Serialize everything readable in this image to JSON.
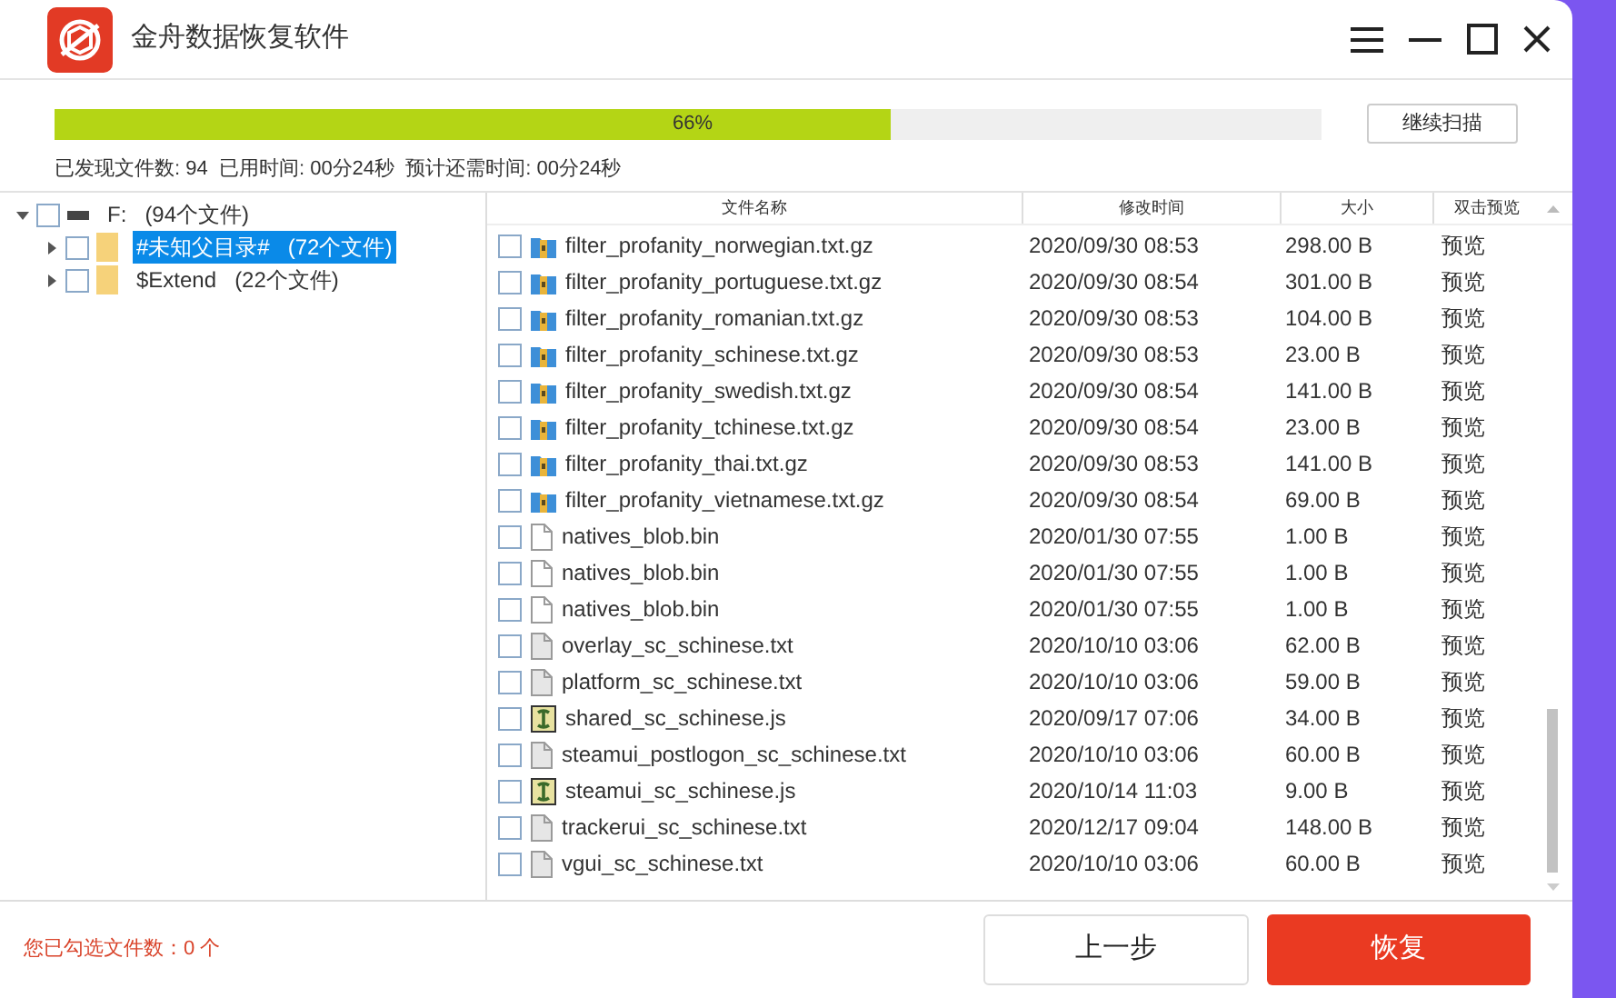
{
  "window": {
    "title": "金舟数据恢复软件"
  },
  "scan": {
    "level": 0.66,
    "percent": "66%",
    "button": "继续扫描",
    "stats": "已发现文件数: 94  已用时间: 00分24秒  预计还需时间: 00分24秒"
  },
  "tree": [
    {
      "label": "F:",
      "count": "(94个文件)",
      "kind": "drive",
      "expanded": true,
      "checked": false,
      "selected": false,
      "children": [
        {
          "label": "#未知父目录#",
          "count": "(72个文件)",
          "kind": "folder",
          "expanded": false,
          "checked": false,
          "selected": true
        },
        {
          "label": "$Extend",
          "count": "(22个文件)",
          "kind": "folder",
          "expanded": false,
          "checked": false,
          "selected": false
        }
      ]
    }
  ],
  "table": {
    "columns": [
      "文件名称",
      "修改时间",
      "大小",
      "双击预览"
    ],
    "rows": [
      {
        "name": "filter_profanity_norwegian.txt.gz",
        "kind": "archive",
        "time": "2020/09/30 08:53",
        "size": "298.00 B",
        "preview": "预览",
        "checked": false
      },
      {
        "name": "filter_profanity_portuguese.txt.gz",
        "kind": "archive",
        "time": "2020/09/30 08:54",
        "size": "301.00 B",
        "preview": "预览",
        "checked": false
      },
      {
        "name": "filter_profanity_romanian.txt.gz",
        "kind": "archive",
        "time": "2020/09/30 08:53",
        "size": "104.00 B",
        "preview": "预览",
        "checked": false
      },
      {
        "name": "filter_profanity_schinese.txt.gz",
        "kind": "archive",
        "time": "2020/09/30 08:53",
        "size": "23.00 B",
        "preview": "预览",
        "checked": false
      },
      {
        "name": "filter_profanity_swedish.txt.gz",
        "kind": "archive",
        "time": "2020/09/30 08:54",
        "size": "141.00 B",
        "preview": "预览",
        "checked": false
      },
      {
        "name": "filter_profanity_tchinese.txt.gz",
        "kind": "archive",
        "time": "2020/09/30 08:54",
        "size": "23.00 B",
        "preview": "预览",
        "checked": false
      },
      {
        "name": "filter_profanity_thai.txt.gz",
        "kind": "archive",
        "time": "2020/09/30 08:53",
        "size": "141.00 B",
        "preview": "预览",
        "checked": false
      },
      {
        "name": "filter_profanity_vietnamese.txt.gz",
        "kind": "archive",
        "time": "2020/09/30 08:54",
        "size": "69.00 B",
        "preview": "预览",
        "checked": false
      },
      {
        "name": "natives_blob.bin",
        "kind": "blank",
        "time": "2020/01/30 07:55",
        "size": "1.00 B",
        "preview": "预览",
        "checked": false
      },
      {
        "name": "natives_blob.bin",
        "kind": "blank",
        "time": "2020/01/30 07:55",
        "size": "1.00 B",
        "preview": "预览",
        "checked": false
      },
      {
        "name": "natives_blob.bin",
        "kind": "blank",
        "time": "2020/01/30 07:55",
        "size": "1.00 B",
        "preview": "预览",
        "checked": false
      },
      {
        "name": "overlay_sc_schinese.txt",
        "kind": "text",
        "time": "2020/10/10 03:06",
        "size": "62.00 B",
        "preview": "预览",
        "checked": false
      },
      {
        "name": "platform_sc_schinese.txt",
        "kind": "text",
        "time": "2020/10/10 03:06",
        "size": "59.00 B",
        "preview": "预览",
        "checked": false
      },
      {
        "name": "shared_sc_schinese.js",
        "kind": "script",
        "time": "2020/09/17 07:06",
        "size": "34.00 B",
        "preview": "预览",
        "checked": false
      },
      {
        "name": "steamui_postlogon_sc_schinese.txt",
        "kind": "text",
        "time": "2020/10/10 03:06",
        "size": "60.00 B",
        "preview": "预览",
        "checked": false
      },
      {
        "name": "steamui_sc_schinese.js",
        "kind": "script",
        "time": "2020/10/14 11:03",
        "size": "9.00 B",
        "preview": "预览",
        "checked": false
      },
      {
        "name": "trackerui_sc_schinese.txt",
        "kind": "text",
        "time": "2020/12/17 09:04",
        "size": "148.00 B",
        "preview": "预览",
        "checked": false
      },
      {
        "name": "vgui_sc_schinese.txt",
        "kind": "text",
        "time": "2020/10/10 03:06",
        "size": "60.00 B",
        "preview": "预览",
        "checked": false
      }
    ]
  },
  "footer": {
    "selected_count": "您已勾选文件数：0 个",
    "back_button": "上一步",
    "recover_button": "恢复"
  }
}
